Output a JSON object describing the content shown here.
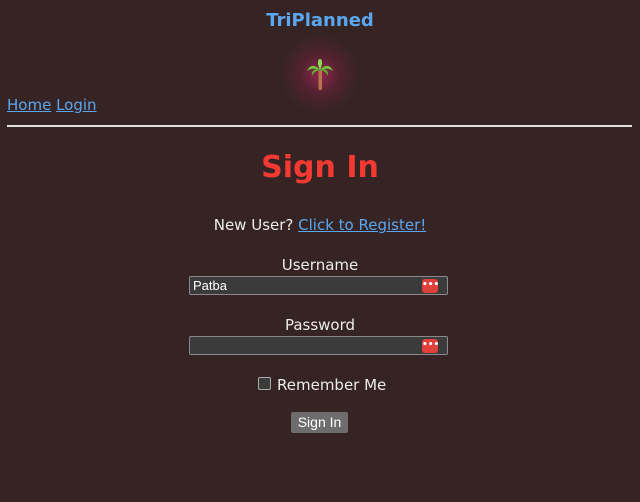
{
  "header": {
    "site_title": "TriPlanned",
    "logo_icon": "palm-tree-icon"
  },
  "nav": {
    "home_label": "Home",
    "login_label": "Login"
  },
  "main": {
    "heading": "Sign In",
    "register_prompt": "New User?",
    "register_link": "Click to Register!",
    "username_label": "Username",
    "username_value": "Patba",
    "password_label": "Password",
    "password_value": "",
    "password_manager_icon": "password-manager-icon",
    "remember_label": "Remember Me",
    "remember_checked": false,
    "submit_label": "Sign In"
  },
  "colors": {
    "background": "#362425",
    "title_blue": "#5aa7ef",
    "heading_red": "#f23a32",
    "manager_icon_red": "#e0403b"
  }
}
